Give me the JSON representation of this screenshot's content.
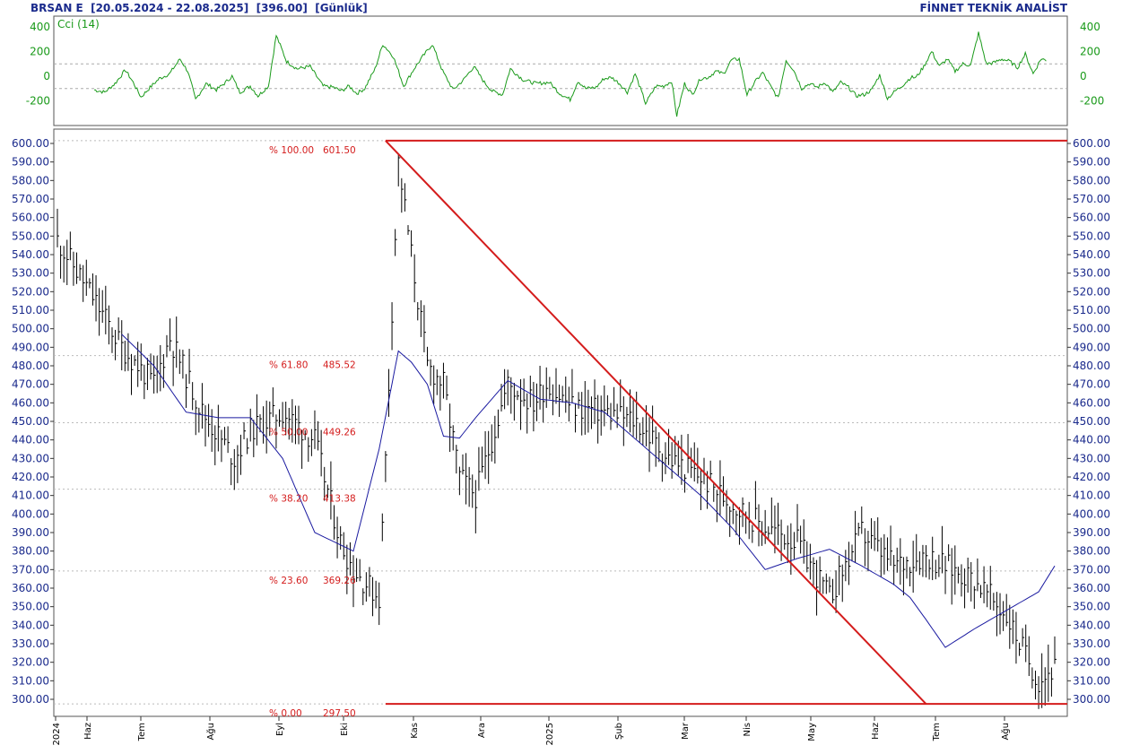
{
  "header": {
    "left": "BRSAN E  [20.05.2024 - 22.08.2025]  [396.00]  [Günlük]",
    "right": "FİNNET TEKNİK ANALİST"
  },
  "colors": {
    "price_bars": "#000000",
    "moving_average": "#1a1aa0",
    "fibonacci": "#d41c1c",
    "cci": "#1a9a1a",
    "axis_text": "#1a2a8c"
  },
  "cci_panel": {
    "label": "Cci (14)",
    "y_ticks": [
      "400",
      "200",
      "0",
      "-200"
    ]
  },
  "chart_data": [
    {
      "type": "line",
      "panel": "indicator",
      "title": "Cci (14)",
      "ylim": [
        -300,
        430
      ],
      "y_ticks": [
        400,
        200,
        0,
        -200
      ],
      "reference_lines": [
        100,
        -100
      ],
      "grid": false,
      "series": [
        {
          "name": "Cci (14)",
          "x": [
            0,
            8,
            16,
            24,
            30,
            36,
            44,
            50,
            58,
            66,
            72,
            78,
            86,
            94,
            100,
            106,
            112,
            120,
            126,
            134,
            140,
            148,
            156,
            166,
            176,
            184,
            190,
            196,
            202,
            208,
            216,
            222,
            230,
            238,
            246,
            252,
            260,
            268,
            276,
            284,
            292,
            300,
            306,
            314,
            320,
            330,
            340,
            350,
            358,
            366,
            372,
            378,
            386,
            392,
            398,
            404,
            410,
            416,
            424,
            432,
            438,
            444,
            448,
            454,
            460,
            466,
            472,
            478,
            484,
            490,
            496,
            502,
            508,
            514,
            520,
            526,
            532,
            538,
            544,
            550,
            556,
            562,
            568,
            574,
            580,
            586,
            592,
            598,
            604,
            610,
            616,
            622,
            628,
            632,
            638,
            644,
            650,
            656,
            662,
            668,
            674,
            680,
            686,
            692,
            698,
            704,
            710,
            716,
            722,
            728,
            732
          ],
          "values": [
            -110,
            -130,
            -60,
            50,
            -50,
            -170,
            -80,
            -20,
            20,
            140,
            40,
            -190,
            -60,
            -110,
            -60,
            0,
            -130,
            -80,
            -160,
            -80,
            330,
            120,
            60,
            80,
            -80,
            -90,
            -120,
            -80,
            -140,
            -100,
            60,
            260,
            160,
            -80,
            60,
            150,
            260,
            40,
            -110,
            -30,
            80,
            -50,
            -120,
            -150,
            60,
            -30,
            -60,
            -50,
            -140,
            -190,
            -40,
            -100,
            -90,
            -20,
            -10,
            -60,
            -130,
            20,
            -220,
            -80,
            -80,
            -40,
            -320,
            -60,
            -150,
            -20,
            -10,
            40,
            20,
            130,
            140,
            -150,
            -50,
            30,
            -80,
            -180,
            130,
            50,
            -100,
            -60,
            -90,
            -50,
            -130,
            -50,
            -90,
            -160,
            -150,
            -110,
            10,
            -180,
            -120,
            -70,
            -10,
            -10,
            80,
            200,
            80,
            140,
            40,
            100,
            90,
            350,
            100,
            110,
            140,
            120,
            70,
            180,
            20,
            140,
            130
          ]
        }
      ]
    },
    {
      "type": "bar",
      "subtype": "ohlc-high-low",
      "panel": "price",
      "ylim": [
        292,
        604
      ],
      "y_ticks": [
        600,
        590,
        580,
        570,
        560,
        550,
        540,
        530,
        520,
        510,
        500,
        490,
        480,
        470,
        460,
        450,
        440,
        430,
        420,
        410,
        400,
        390,
        380,
        370,
        360,
        350,
        340,
        330,
        320,
        310,
        300
      ],
      "x_ticks": [
        "2024",
        "Haz",
        "Tem",
        "Ağu",
        "Eyl",
        "Eki",
        "Kas",
        "Ara",
        "2025",
        "Şub",
        "Mar",
        "Nis",
        "May",
        "Haz",
        "Tem",
        "Ağu"
      ],
      "fibonacci": {
        "levels": [
          {
            "pct": "% 100.00",
            "value": "601.50"
          },
          {
            "pct": "% 61.80",
            "value": "485.52"
          },
          {
            "pct": "% 50.00",
            "value": "449.26"
          },
          {
            "pct": "% 38.20",
            "value": "413.38"
          },
          {
            "pct": "% 23.60",
            "value": "369.26"
          },
          {
            "pct": "% 0.00",
            "value": "297.50"
          }
        ],
        "start_index": 102,
        "end_index": 270
      },
      "series": [
        {
          "name": "Price",
          "x_dense": [
            0,
            10,
            20,
            30,
            35,
            45,
            55,
            60,
            70,
            80,
            88,
            92,
            100,
            102,
            106,
            110,
            115,
            120,
            125,
            130,
            140,
            148,
            152,
            160,
            170,
            180,
            190,
            200,
            210,
            220,
            230,
            240,
            250,
            260,
            265,
            270,
            276,
            285,
            295,
            305,
            310
          ],
          "close_dense": [
            548,
            520,
            490,
            470,
            495,
            455,
            430,
            445,
            455,
            440,
            385,
            370,
            355,
            430,
            590,
            540,
            480,
            470,
            420,
            410,
            470,
            460,
            470,
            458,
            455,
            450,
            430,
            420,
            405,
            393,
            385,
            355,
            390,
            372,
            375,
            378,
            372,
            365,
            345,
            310,
            317
          ]
        },
        {
          "name": "Moving average",
          "x_dense": [
            20,
            30,
            40,
            50,
            60,
            70,
            80,
            92,
            100,
            106,
            110,
            115,
            120,
            125,
            130,
            140,
            150,
            160,
            170,
            180,
            190,
            200,
            210,
            220,
            230,
            240,
            250,
            260,
            265,
            270,
            276,
            285,
            295,
            305,
            310
          ],
          "close_dense": [
            497,
            480,
            455,
            452,
            452,
            430,
            390,
            380,
            435,
            488,
            482,
            470,
            442,
            441,
            452,
            472,
            462,
            460,
            455,
            440,
            425,
            410,
            392,
            370,
            376,
            381,
            372,
            362,
            355,
            343,
            328,
            338,
            348,
            358,
            372
          ]
        }
      ]
    }
  ]
}
